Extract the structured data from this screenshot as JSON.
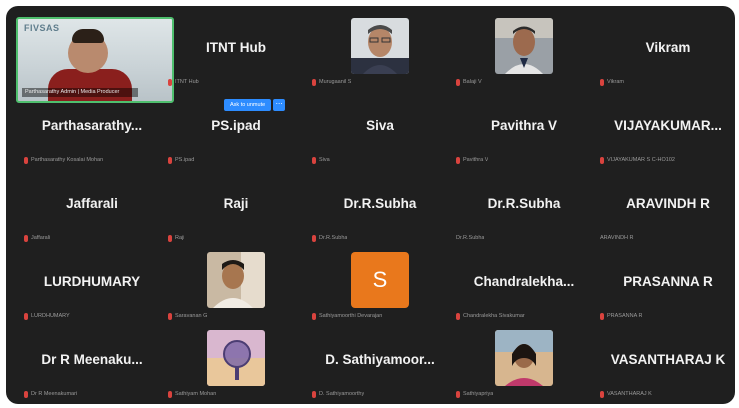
{
  "colors": {
    "background": "#1f1f1f",
    "active_border": "#4fbf6e",
    "mic_muted": "#d9433e",
    "avatar_orange": "#e9781c",
    "tooltip": "#2d8cff"
  },
  "self_video": {
    "watermark": "FIVSAS",
    "caption": "Parthasarathy Admin | Media Producer"
  },
  "tooltip": {
    "label": "Ask to unmute"
  },
  "participants": [
    {
      "kind": "video",
      "sub": ""
    },
    {
      "kind": "name",
      "name": "ITNT Hub",
      "sub": "ITNT Hub"
    },
    {
      "kind": "photo",
      "photo_icon": "man-glasses-icon",
      "sub": "Murugaanil S"
    },
    {
      "kind": "photo",
      "photo_icon": "man-portrait-icon",
      "sub": "Balaji V"
    },
    {
      "kind": "name",
      "name": "Vikram",
      "sub": "Vikram"
    },
    {
      "kind": "name",
      "name": "Parthasarathy...",
      "sub": "Parthasarathy Kosalai Mohan"
    },
    {
      "kind": "name",
      "name": "PS.ipad",
      "sub": "PS.ipad"
    },
    {
      "kind": "name",
      "name": "Siva",
      "sub": "Siva"
    },
    {
      "kind": "name",
      "name": "Pavithra V",
      "sub": "Pavithra V"
    },
    {
      "kind": "name",
      "name": "VIJAYAKUMAR...",
      "sub": "VIJAYAKUMAR S C-HO102"
    },
    {
      "kind": "name",
      "name": "Jaffarali",
      "sub": "Jaffarali"
    },
    {
      "kind": "name",
      "name": "Raji",
      "sub": "Raji"
    },
    {
      "kind": "name",
      "name": "Dr.R.Subha",
      "sub": "Dr.R.Subha"
    },
    {
      "kind": "name",
      "name": "Dr.R.Subha",
      "sub": "Dr.R.Subha"
    },
    {
      "kind": "name",
      "name": "ARAVINDH R",
      "sub": "ARAVINDH R"
    },
    {
      "kind": "name",
      "name": "LURDHUMARY",
      "sub": "LURDHUMARY"
    },
    {
      "kind": "photo",
      "photo_icon": "person-casual-icon",
      "sub": "Saravanan G"
    },
    {
      "kind": "initial",
      "initial": "S",
      "sub": "Sathiyamoorthi Devarajan"
    },
    {
      "kind": "name",
      "name": "Chandralekha...",
      "sub": "Chandralekha Sivakumar"
    },
    {
      "kind": "name",
      "name": "PRASANNA R",
      "sub": "PRASANNA R"
    },
    {
      "kind": "name",
      "name": "Dr R Meenaku...",
      "sub": "Dr R Meenakumari"
    },
    {
      "kind": "photo",
      "photo_icon": "globe-sky-icon",
      "sub": "Sathiyam Mohan"
    },
    {
      "kind": "name",
      "name": "D. Sathiyamoor...",
      "sub": "D. Sathiyamoorthy"
    },
    {
      "kind": "photo",
      "photo_icon": "woman-portrait-icon",
      "sub": "Sathiyapriya"
    },
    {
      "kind": "name",
      "name": "VASANTHARAJ K",
      "sub": "VASANTHARAJ K"
    }
  ]
}
